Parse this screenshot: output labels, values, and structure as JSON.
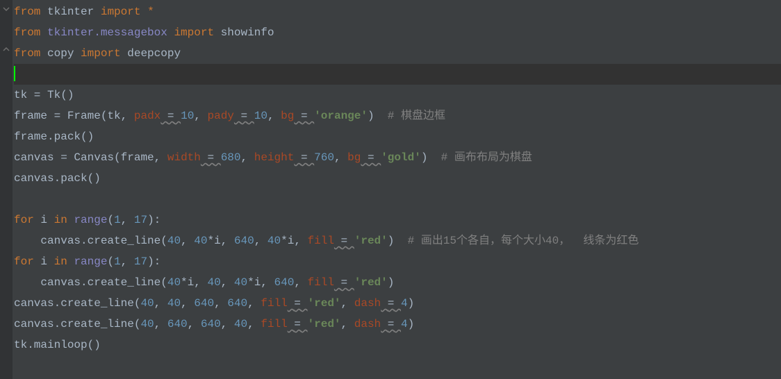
{
  "code": {
    "l1": {
      "from": "from",
      "mod": "tkinter",
      "import": "import",
      "star": "*"
    },
    "l2": {
      "from": "from",
      "mod": "tkinter.messagebox",
      "import": "import",
      "name": "showinfo"
    },
    "l3": {
      "from": "from",
      "mod": "copy",
      "import": "import",
      "name": "deepcopy"
    },
    "l5": {
      "tk": "tk",
      "eq": " = ",
      "Tk": "Tk",
      "p": "()"
    },
    "l6": {
      "frame": "frame",
      "eq": " = ",
      "Frame": "Frame",
      "open": "(",
      "tk": "tk",
      "c1": ", ",
      "padx": "padx",
      "sp1": " ",
      "u1": "=",
      "sp2": " ",
      "v1": "10",
      "c2": ", ",
      "pady": "pady",
      "sp3": " ",
      "u2": "=",
      "sp4": " ",
      "v2": "10",
      "c3": ", ",
      "bg": "bg",
      "sp5": " ",
      "u3": "=",
      "sp6": " ",
      "s": "'orange'",
      "close": ")",
      "sp7": "  ",
      "hash": "# ",
      "cmt": "棋盘边框"
    },
    "l7": {
      "t": "frame.pack()"
    },
    "l8": {
      "canvas": "canvas",
      "eq": " = ",
      "Canvas": "Canvas",
      "open": "(",
      "frame": "frame",
      "c1": ", ",
      "width": "width",
      "sp1": " ",
      "u1": "=",
      "sp2": " ",
      "v1": "680",
      "c2": ", ",
      "height": "height",
      "sp3": " ",
      "u2": "=",
      "sp4": " ",
      "v2": "760",
      "c3": ", ",
      "bg": "bg",
      "sp5": " ",
      "u3": "=",
      "sp6": " ",
      "s": "'gold'",
      "close": ")",
      "sp7": "  ",
      "hash": "# ",
      "cmt": "画布布局为棋盘"
    },
    "l9": {
      "t": "canvas.pack()"
    },
    "l11": {
      "for": "for",
      "i": " i ",
      "in": "in",
      "sp": " ",
      "range": "range",
      "open": "(",
      "a": "1",
      "c": ", ",
      "b": "17",
      "close": "):"
    },
    "l12": {
      "indent": "    ",
      "call": "canvas.create_line(",
      "a": "40",
      "c1": ", ",
      "b1": "40",
      "st1": "*",
      "i1": "i",
      "c2": ", ",
      "d": "640",
      "c3": ", ",
      "b2": "40",
      "st2": "*",
      "i2": "i",
      "c4": ", ",
      "fill": "fill",
      "sp1": " ",
      "u1": "=",
      "sp2": " ",
      "s": "'red'",
      "close": ")",
      "sp3": "  ",
      "hash": "# ",
      "cmt": "画出15个各自，每个大小40，  线条为红色"
    },
    "l13": {
      "for": "for",
      "i": " i ",
      "in": "in",
      "sp": " ",
      "range": "range",
      "open": "(",
      "a": "1",
      "c": ", ",
      "b": "17",
      "close": "):"
    },
    "l14": {
      "indent": "    ",
      "call": "canvas.create_line(",
      "b1": "40",
      "st1": "*",
      "i1": "i",
      "c1": ", ",
      "a": "40",
      "c2": ", ",
      "b2": "40",
      "st2": "*",
      "i2": "i",
      "c3": ", ",
      "d": "640",
      "c4": ", ",
      "fill": "fill",
      "sp1": " ",
      "u1": "=",
      "sp2": " ",
      "s": "'red'",
      "close": ")"
    },
    "l15": {
      "call": "canvas.create_line(",
      "a": "40",
      "c1": ", ",
      "b": "40",
      "c2": ", ",
      "d": "640",
      "c3": ", ",
      "e": "640",
      "c4": ", ",
      "fill": "fill",
      "sp1": " ",
      "u1": "=",
      "sp2": " ",
      "s": "'red'",
      "c5": ", ",
      "dash": "dash",
      "sp3": " ",
      "u2": "=",
      "sp4": " ",
      "v": "4",
      "close": ")"
    },
    "l16": {
      "call": "canvas.create_line(",
      "a": "40",
      "c1": ", ",
      "b": "640",
      "c2": ", ",
      "d": "640",
      "c3": ", ",
      "e": "40",
      "c4": ", ",
      "fill": "fill",
      "sp1": " ",
      "u1": "=",
      "sp2": " ",
      "s": "'red'",
      "c5": ", ",
      "dash": "dash",
      "sp3": " ",
      "u2": "=",
      "sp4": " ",
      "v": "4",
      "close": ")"
    },
    "l17": {
      "t": "tk.mainloop()"
    }
  }
}
